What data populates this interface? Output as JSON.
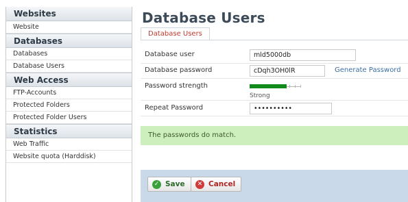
{
  "sidebar": {
    "groups": [
      {
        "title": "Websites",
        "items": [
          "Website"
        ]
      },
      {
        "title": "Databases",
        "items": [
          "Databases",
          "Database Users"
        ]
      },
      {
        "title": "Web Access",
        "items": [
          "FTP-Accounts",
          "Protected Folders",
          "Protected Folder Users"
        ]
      },
      {
        "title": "Statistics",
        "items": [
          "Web Traffic",
          "Website quota (Harddisk)"
        ]
      }
    ]
  },
  "page": {
    "title": "Database Users",
    "tab_label": "Database Users"
  },
  "form": {
    "db_user_label": "Database user",
    "db_user_value": "mld5000db",
    "db_password_label": "Database password",
    "db_password_value": "cDqh3OH0lR",
    "generate_password_label": "Generate Password",
    "strength_label": "Password strength",
    "strength_value_text": "Strong",
    "strength_fraction": 0.72,
    "repeat_label": "Repeat Password",
    "repeat_value": "••••••••••",
    "match_message": "The passwords do match."
  },
  "buttons": {
    "save_label": "Save",
    "cancel_label": "Cancel"
  },
  "colors": {
    "strength_strong": "#138a1c",
    "match_background": "#cdeebd",
    "tab_text": "#c0392b"
  }
}
